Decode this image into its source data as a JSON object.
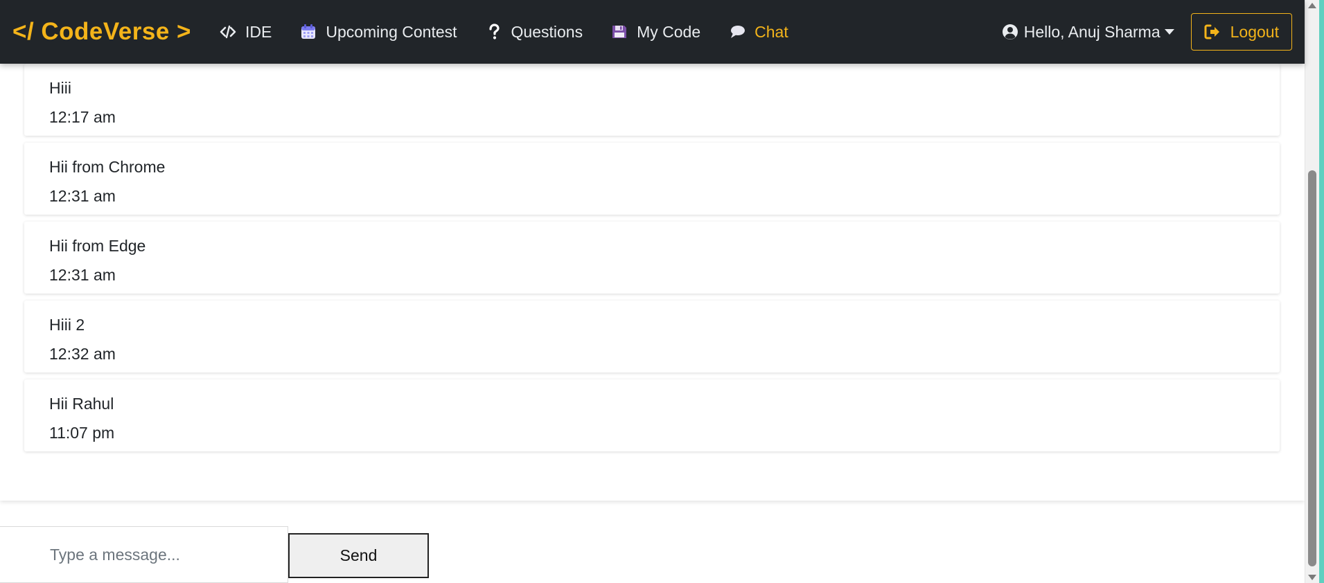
{
  "brand": "</ CodeVerse >",
  "nav": {
    "items": [
      {
        "label": "IDE",
        "icon": "code-icon"
      },
      {
        "label": "Upcoming Contest",
        "icon": "calendar-icon"
      },
      {
        "label": "Questions",
        "icon": "question-icon"
      },
      {
        "label": "My Code",
        "icon": "floppy-disk-icon"
      },
      {
        "label": "Chat",
        "icon": "chat-bubble-icon",
        "active": true
      }
    ],
    "user_label": "Hello, Anuj Sharma",
    "logout_label": "Logout"
  },
  "messages": [
    {
      "text": "Hiii",
      "time": "12:17 am"
    },
    {
      "text": "Hii from Chrome",
      "time": "12:31 am"
    },
    {
      "text": "Hii from Edge",
      "time": "12:31 am"
    },
    {
      "text": "Hiii 2",
      "time": "12:32 am"
    },
    {
      "text": "Hii Rahul",
      "time": "11:07 pm"
    }
  ],
  "composer": {
    "placeholder": "Type a message...",
    "send_label": "Send"
  },
  "colors": {
    "navbar_bg": "#212529",
    "accent": "#f4b41a",
    "edge_strip": "#5fd0c0"
  }
}
